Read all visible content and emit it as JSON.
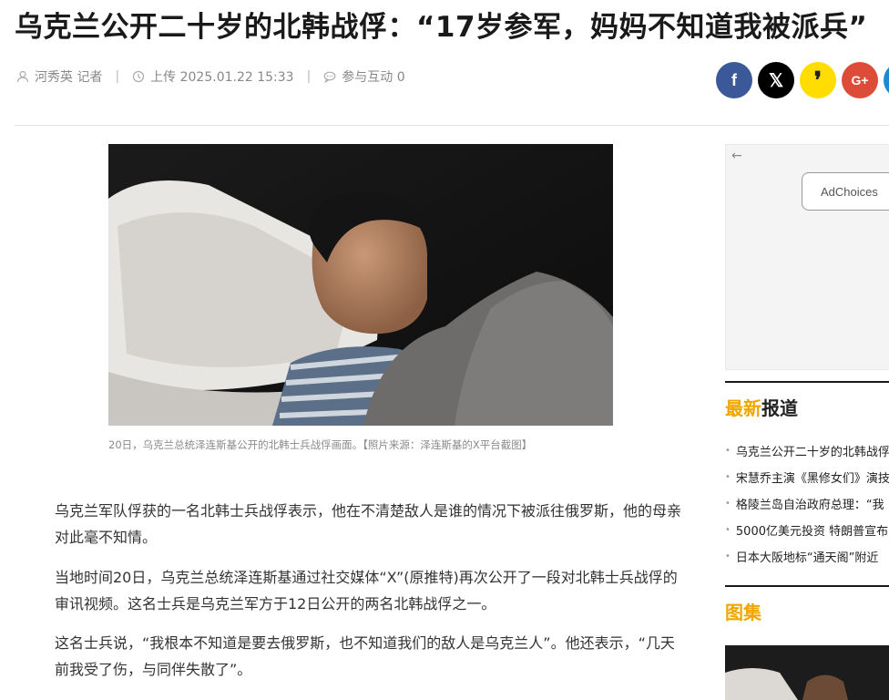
{
  "article": {
    "title": "乌克兰公开二十岁的北韩战俘：“17岁参军，妈妈不知道我被派兵”",
    "author": "河秀英 记者",
    "uploaded": "上传 2025.01.22 15:33",
    "comments": "参与互动 0",
    "caption": "20日，乌克兰总统泽连斯基公开的北韩士兵战俘画面。【照片来源：泽连斯基的X平台截图】",
    "paragraphs": [
      "乌克兰军队俘获的一名北韩士兵战俘表示，他在不清楚敌人是谁的情况下被派往俄罗斯，他的母亲对此毫不知情。",
      "当地时间20日，乌克兰总统泽连斯基通过社交媒体“X”(原推特)再次公开了一段对北韩士兵战俘的审讯视频。这名士兵是乌克兰军方于12日公开的两名北韩战俘之一。",
      "这名士兵说，“我根本不知道是要去俄罗斯，也不知道我们的敌人是乌克兰人”。他还表示，“几天前我受了伤，与同伴失散了”。"
    ]
  },
  "share": {
    "facebook": "f",
    "x": "𝕏",
    "kakao": "❜",
    "google": "G+",
    "colors": {
      "facebook": "#3b5998",
      "x": "#000000",
      "kakao": "#ffdd00",
      "google": "#dd4b39",
      "extra": "#1b8ad0"
    }
  },
  "sidebar": {
    "ad_back": "←",
    "ad_choices": "AdChoices",
    "latest_hl": "最新",
    "latest_rest": "报道",
    "latest_items": [
      "乌克兰公开二十岁的北韩战俘",
      "宋慧乔主演《黑修女们》演技",
      "格陵兰岛自治政府总理：“我",
      "5000亿美元投资 特朗普宣布",
      "日本大阪地标“通天阁”附近"
    ],
    "gallery": "图集"
  }
}
